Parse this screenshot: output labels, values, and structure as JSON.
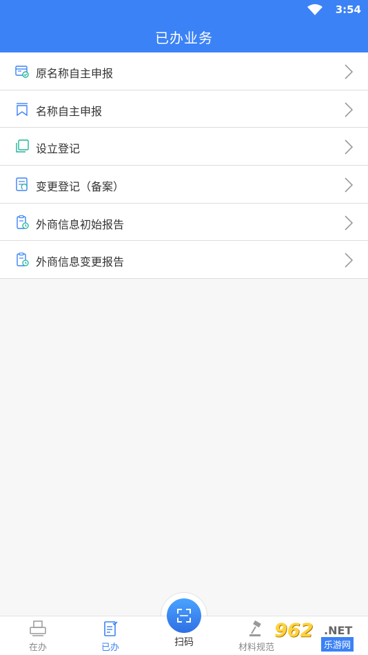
{
  "status_bar": {
    "time": "3:54"
  },
  "header": {
    "title": "已办业务"
  },
  "list": {
    "items": [
      {
        "label": "原名称自主申报",
        "icon": "id-card-check-icon"
      },
      {
        "label": "名称自主申报",
        "icon": "bookmark-icon"
      },
      {
        "label": "设立登记",
        "icon": "copy-icon"
      },
      {
        "label": "变更登记（备案）",
        "icon": "document-edit-icon"
      },
      {
        "label": "外商信息初始报告",
        "icon": "clipboard-clock-icon"
      },
      {
        "label": "外商信息变更报告",
        "icon": "clipboard-clock-icon"
      }
    ]
  },
  "tab_bar": {
    "tabs": [
      {
        "label": "在办",
        "icon": "printer-icon"
      },
      {
        "label": "已办",
        "icon": "doc-check-icon",
        "active": true
      },
      {
        "label": "扫码",
        "icon": "scan-icon"
      },
      {
        "label": "材料规范",
        "icon": "gavel-icon"
      }
    ]
  },
  "watermark": {
    "logo": "962",
    "domain": ".NET",
    "subtitle": "乐游网"
  },
  "colors": {
    "primary": "#3b82f6",
    "icon_teal": "#1fb39a",
    "icon_blue": "#3b82f6"
  }
}
